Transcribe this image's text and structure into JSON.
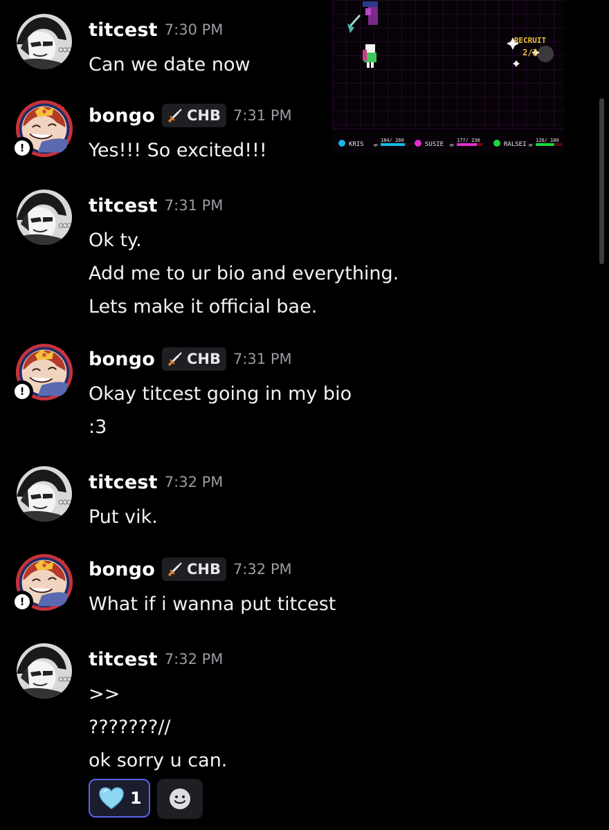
{
  "colors": {
    "background": "#000000",
    "text": "#f2f3f5",
    "timestamp": "#9a9ca3",
    "reaction_border": "#5865f2",
    "scrollbar": "#3a3c42"
  },
  "game_embed": {
    "recruit_label": "RECRUIT",
    "recruit_count": "2/2",
    "party": [
      {
        "name": "KRIS",
        "hp_label": "HP",
        "hp": "184/ 200",
        "bar_color": "#16b8e6",
        "hp_fraction": 0.92
      },
      {
        "name": "SUSIE",
        "hp_label": "HP",
        "hp": "177/ 230",
        "bar_color": "#e22ed0",
        "hp_fraction": 0.77
      },
      {
        "name": "RALSEI",
        "hp_label": "HP",
        "hp": "126/ 180",
        "bar_color": "#18d83a",
        "hp_fraction": 0.7
      }
    ]
  },
  "messages": [
    {
      "author": "titcest",
      "time": "7:30 PM",
      "lines": [
        "Can we date now"
      ]
    },
    {
      "author": "bongo",
      "tag": "CHB",
      "time": "7:31 PM",
      "lines": [
        "Yes!!! So excited!!!"
      ]
    },
    {
      "author": "titcest",
      "time": "7:31 PM",
      "lines": [
        "Ok ty.",
        "Add me to ur bio and everything.",
        "Lets make it official bae."
      ]
    },
    {
      "author": "bongo",
      "tag": "CHB",
      "time": "7:31 PM",
      "lines": [
        "Okay titcest going in my bio",
        ":3"
      ]
    },
    {
      "author": "titcest",
      "time": "7:32 PM",
      "lines": [
        "Put vik."
      ]
    },
    {
      "author": "bongo",
      "tag": "CHB",
      "time": "7:32 PM",
      "lines": [
        "What if i wanna put titcest"
      ]
    },
    {
      "author": "titcest",
      "time": "7:32 PM",
      "lines": [
        ">>",
        "???????//",
        "ok sorry u can."
      ]
    }
  ],
  "reactions": [
    {
      "emoji": "light-blue-heart-icon",
      "count": "1",
      "selected": true
    }
  ],
  "add_reaction_icon": "smiley-add-reaction-icon"
}
